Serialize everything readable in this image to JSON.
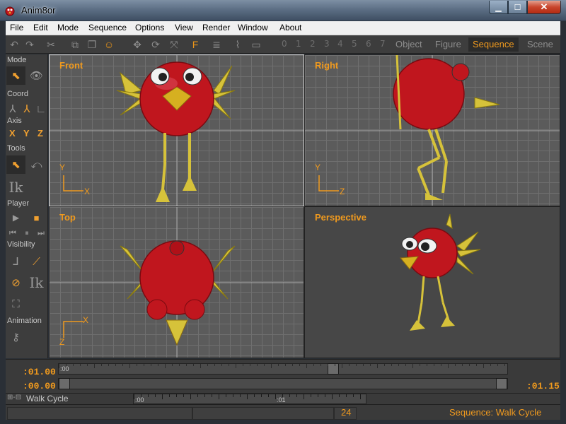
{
  "window": {
    "title": "Anim8or"
  },
  "menu": [
    "File",
    "Edit",
    "Mode",
    "Sequence",
    "Options",
    "View",
    "Render",
    "Window",
    "About"
  ],
  "toolbar": {
    "keyframes": [
      "0",
      "1",
      "2",
      "3",
      "4",
      "5",
      "6",
      "7"
    ],
    "modes": [
      "Object",
      "Figure",
      "Sequence",
      "Scene"
    ],
    "active_mode": "Sequence"
  },
  "tools": {
    "mode_label": "Mode",
    "coord_label": "Coord",
    "axis_label": "Axis",
    "axis_letters": [
      "X",
      "Y",
      "Z"
    ],
    "tools_label": "Tools",
    "ik_label": "Ik",
    "player_label": "Player",
    "visibility_label": "Visibility",
    "animation_label": "Animation"
  },
  "viewports": {
    "front": {
      "label": "Front",
      "axis_v": "Y",
      "axis_h": "X"
    },
    "right": {
      "label": "Right",
      "axis_v": "Y",
      "axis_h": "Z"
    },
    "top": {
      "label": "Top",
      "axis_v": "Z",
      "axis_h": "X"
    },
    "perspective": {
      "label": "Perspective"
    }
  },
  "timeline": {
    "current_time": ":01.00",
    "start_time": ":00.00",
    "end_time": ":01.15",
    "track_marker": ":00",
    "ruler_marks": [
      ":00",
      ":01"
    ]
  },
  "sequence": {
    "name": "Walk Cycle",
    "toggle_glyph": "⊞-⊟"
  },
  "status": {
    "frame": "24",
    "sequence_text": "Sequence: Walk Cycle"
  },
  "colors": {
    "accent": "#f09a1e",
    "bird_body": "#c0161e",
    "bones": "#d6c23a"
  }
}
